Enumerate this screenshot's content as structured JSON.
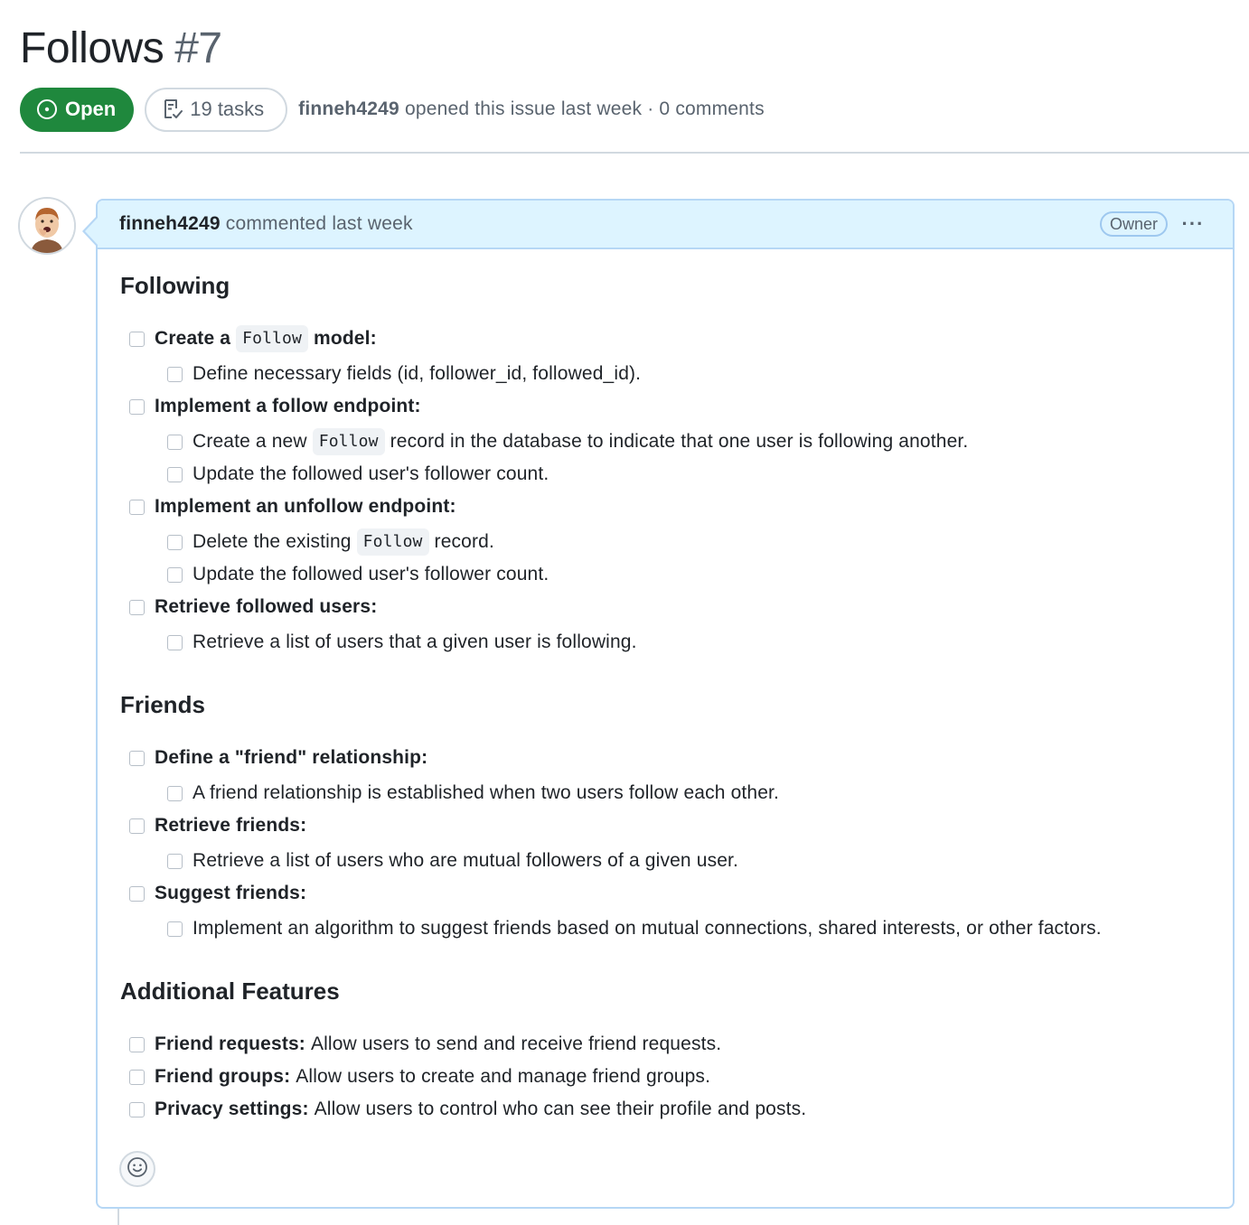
{
  "issue": {
    "title": "Follows",
    "number": "#7",
    "state": "Open",
    "tasks_label": "19 tasks",
    "author": "finneh4249",
    "meta_suffix": "opened this issue last week · 0 comments"
  },
  "comment": {
    "author": "finneh4249",
    "meta": "commented last week",
    "badge": "Owner",
    "menu_label": "···"
  },
  "sections": {
    "following": {
      "heading": "Following",
      "create_follow": {
        "pre": "Create a",
        "code": "Follow",
        "post": "model:"
      },
      "define_fields": "Define necessary fields (id, follower_id, followed_id).",
      "follow_endpoint": "Implement a follow endpoint:",
      "create_new": {
        "pre": "Create a new",
        "code": "Follow",
        "post": "record in the database to indicate that one user is following another."
      },
      "update_count_1": "Update the followed user's follower count.",
      "unfollow_endpoint": "Implement an unfollow endpoint:",
      "delete_existing": {
        "pre": "Delete the existing",
        "code": "Follow",
        "post": "record."
      },
      "update_count_2": "Update the followed user's follower count.",
      "retrieve_followed": "Retrieve followed users:",
      "retrieve_list": "Retrieve a list of users that a given user is following."
    },
    "friends": {
      "heading": "Friends",
      "define_friend": "Define a \"friend\" relationship:",
      "friend_established": "A friend relationship is established when two users follow each other.",
      "retrieve_friends": "Retrieve friends:",
      "retrieve_mutual": "Retrieve a list of users who are mutual followers of a given user.",
      "suggest_friends": "Suggest friends:",
      "suggest_algorithm": "Implement an algorithm to suggest friends based on mutual connections, shared interests, or other factors."
    },
    "additional": {
      "heading": "Additional Features",
      "friend_requests": {
        "label": "Friend requests:",
        "text": "Allow users to send and receive friend requests."
      },
      "friend_groups": {
        "label": "Friend groups:",
        "text": "Allow users to create and manage friend groups."
      },
      "privacy": {
        "label": "Privacy settings:",
        "text": "Allow users to control who can see their profile and posts."
      }
    }
  },
  "colors": {
    "open_green": "#1f883d",
    "header_blue": "#ddf4ff",
    "border_blue": "#b6d7f5",
    "muted": "#59636e"
  },
  "icons": {
    "state": "issue-opened-icon",
    "tasks": "checklist-icon",
    "reaction": "smiley-icon",
    "menu": "kebab-horizontal-icon"
  }
}
